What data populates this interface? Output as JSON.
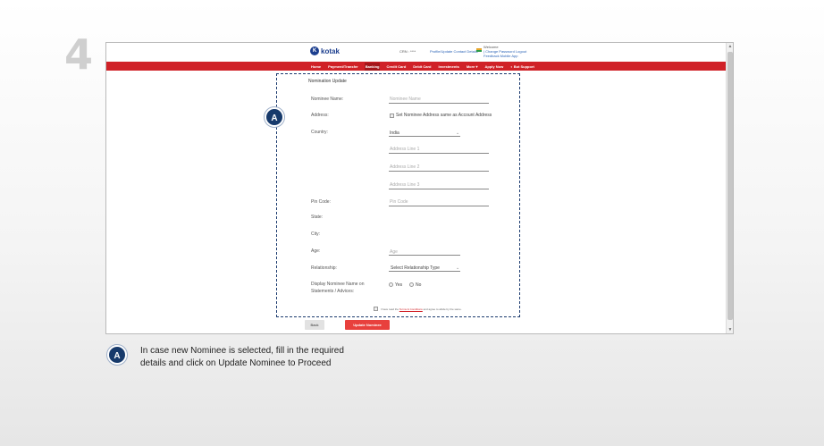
{
  "step_number": "4",
  "header": {
    "logo_mark": "K",
    "logo_text": "kotak",
    "crn": "CRN : ****",
    "profile_link": "Profile/Update Contact Details",
    "welcome_line1": "Welcome",
    "welcome_line2": "| Change Password Logout",
    "welcome_line3": "Feedback Mobile App"
  },
  "nav": {
    "items": [
      "Home",
      "Payment/Transfer",
      "Banking",
      "Credit Card",
      "Debit Card",
      "Investments",
      "More ▾",
      "Apply Now",
      "◐ Bot Support"
    ]
  },
  "form": {
    "title": "Nomination Update",
    "nominee_name_label": "Nominee Name:",
    "nominee_name_placeholder": "Nominee Name",
    "address_label": "Address:",
    "same_address_label": "Set Nominee Address same as Account Address",
    "country_label": "Country:",
    "country_value": "India",
    "address_line1_placeholder": "Address Line 1",
    "address_line2_placeholder": "Address Line 2",
    "address_line3_placeholder": "Address Line 3",
    "pincode_label": "Pin Code:",
    "pincode_placeholder": "Pin Code",
    "state_label": "State:",
    "city_label": "City:",
    "age_label": "Age:",
    "age_placeholder": "Age",
    "relationship_label": "Relationship:",
    "relationship_value": "Select Relationship Type",
    "display_label_line1": "Display Nominee Name on",
    "display_label_line2": "Statements / Advices:",
    "yes_label": "Yes",
    "no_label": "No",
    "terms_prefix": "I have read the",
    "terms_link": "Terms & Conditions",
    "terms_suffix": "and agree to abide by the same.",
    "back_label": "Back",
    "update_label": "Update Nominee"
  },
  "callout": {
    "badge": "A",
    "note_badge": "A",
    "note_line1": "In case new Nominee is selected, fill in the required",
    "note_line2": "details and click on Update Nominee to Proceed"
  },
  "colors": {
    "brand_red": "#d02127",
    "brand_blue": "#1d3f8f",
    "badge_blue": "#173a6b",
    "button_red": "#e8403d"
  }
}
